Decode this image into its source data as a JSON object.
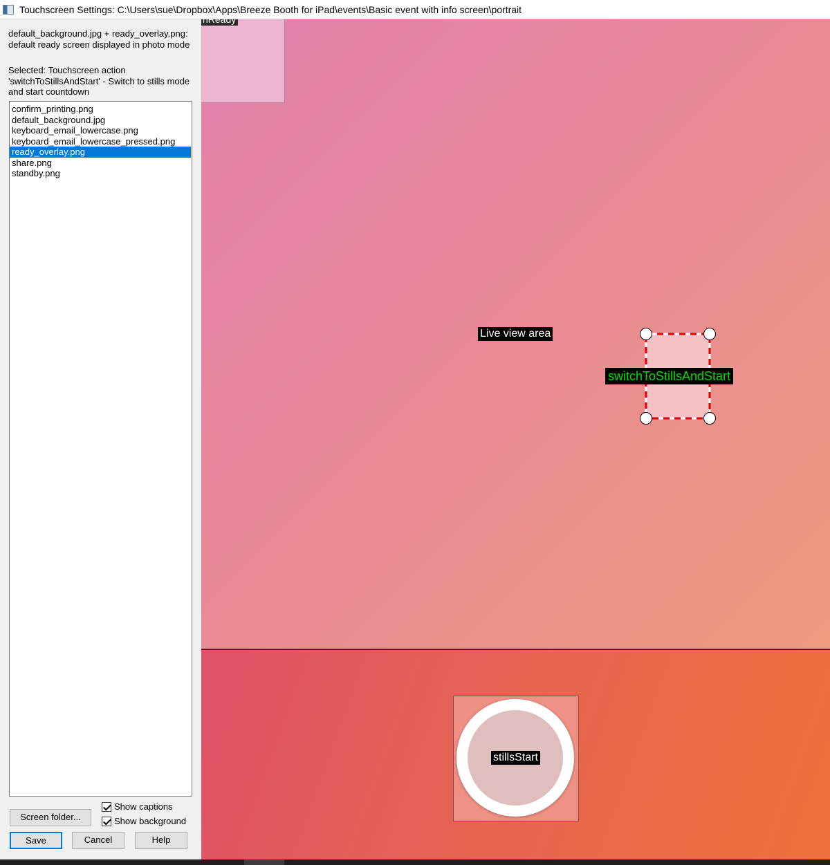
{
  "window": {
    "title": "Touchscreen Settings: C:\\Users\\sue\\Dropbox\\Apps\\Breeze Booth for iPad\\events\\Basic event with info screen\\portrait"
  },
  "left_panel": {
    "description": "default_background.jpg + ready_overlay.png: default ready screen displayed in photo mode",
    "selection": "Selected: Touchscreen action 'switchToStillsAndStart' - Switch to stills mode and start countdown",
    "files": [
      "confirm_printing.png",
      "default_background.jpg",
      "keyboard_email_lowercase.png",
      "keyboard_email_lowercase_pressed.png",
      "ready_overlay.png",
      "share.png",
      "standby.png"
    ],
    "selected_file": "ready_overlay.png",
    "screen_folder_label": "Screen folder...",
    "show_captions_label": "Show captions",
    "show_captions_checked": true,
    "show_background_label": "Show background",
    "show_background_checked": true,
    "save_label": "Save",
    "cancel_label": "Cancel",
    "help_label": "Help"
  },
  "canvas": {
    "ready_label": "nReady",
    "live_view_label": "Live view area",
    "action_caption": "switchToStillsAndStart",
    "start_caption": "stillsStart"
  }
}
